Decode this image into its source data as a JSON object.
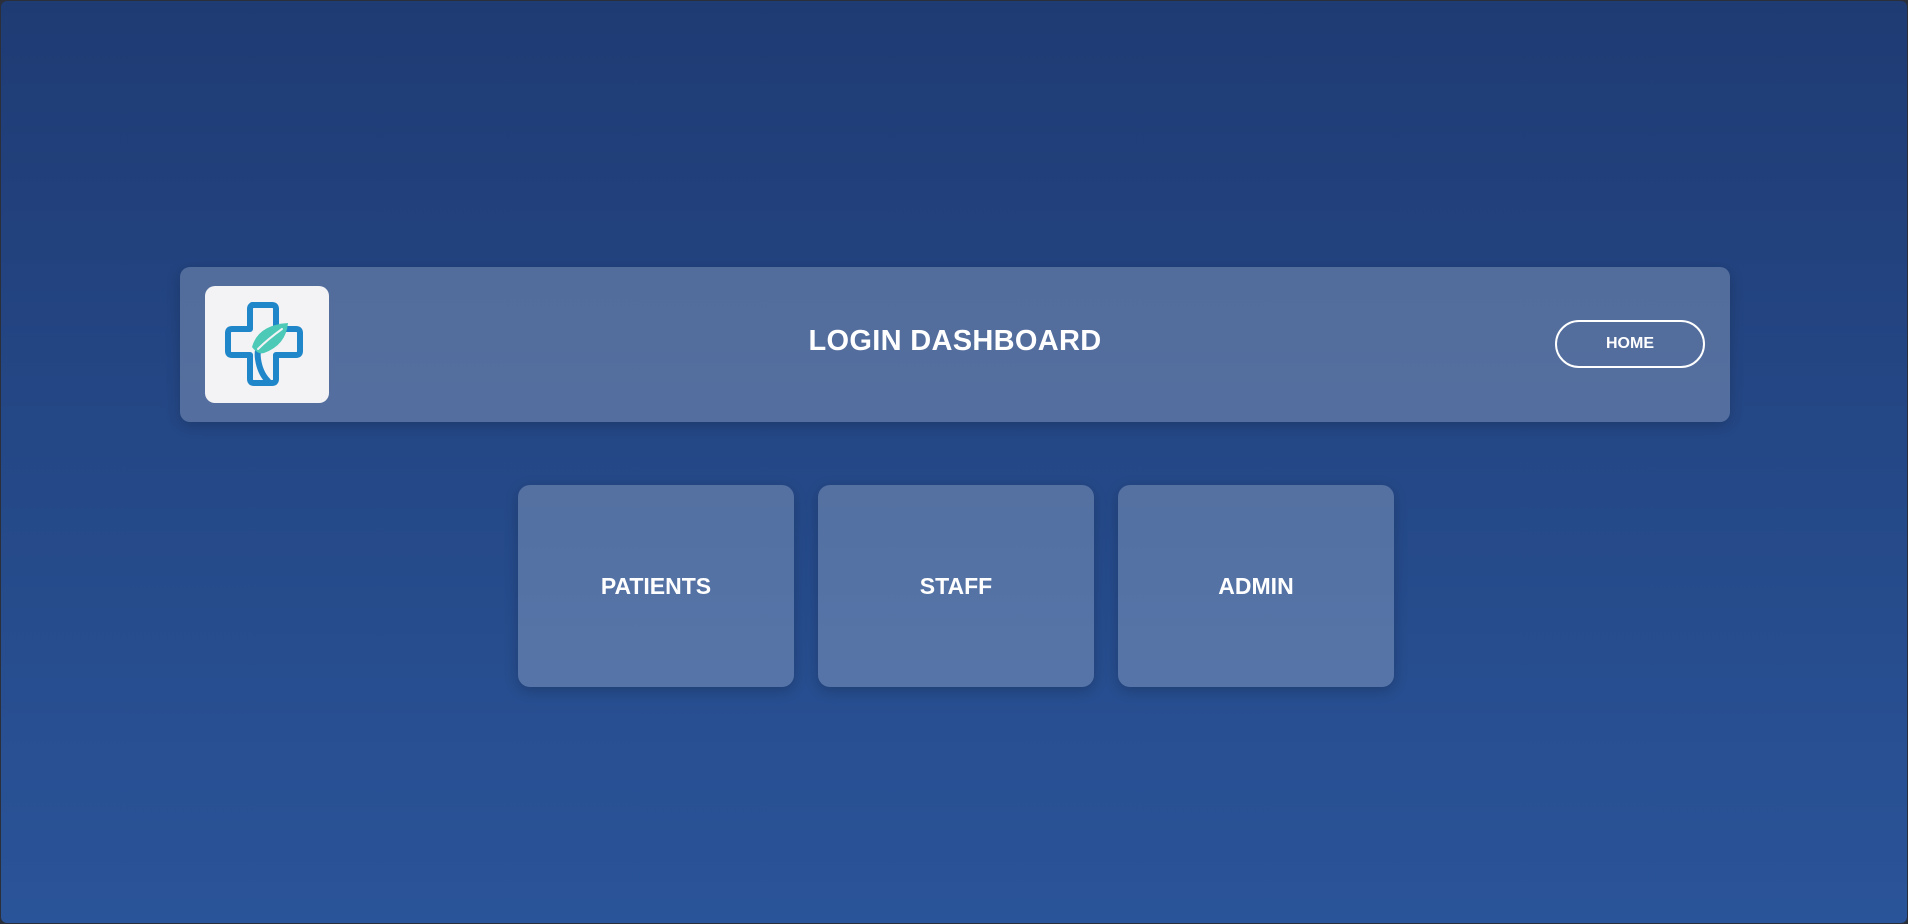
{
  "header": {
    "logo_icon": "medical-cross-leaf-icon",
    "title": "LOGIN DASHBOARD",
    "home_label": "HOME"
  },
  "cards": [
    {
      "label": "PATIENTS"
    },
    {
      "label": "STAFF"
    },
    {
      "label": "ADMIN"
    }
  ],
  "colors": {
    "background_top": "#1f3b74",
    "background_bottom": "#2a5499",
    "logo_blue": "#1f86c9",
    "logo_teal": "#4cc9b7",
    "text": "#ffffff"
  }
}
